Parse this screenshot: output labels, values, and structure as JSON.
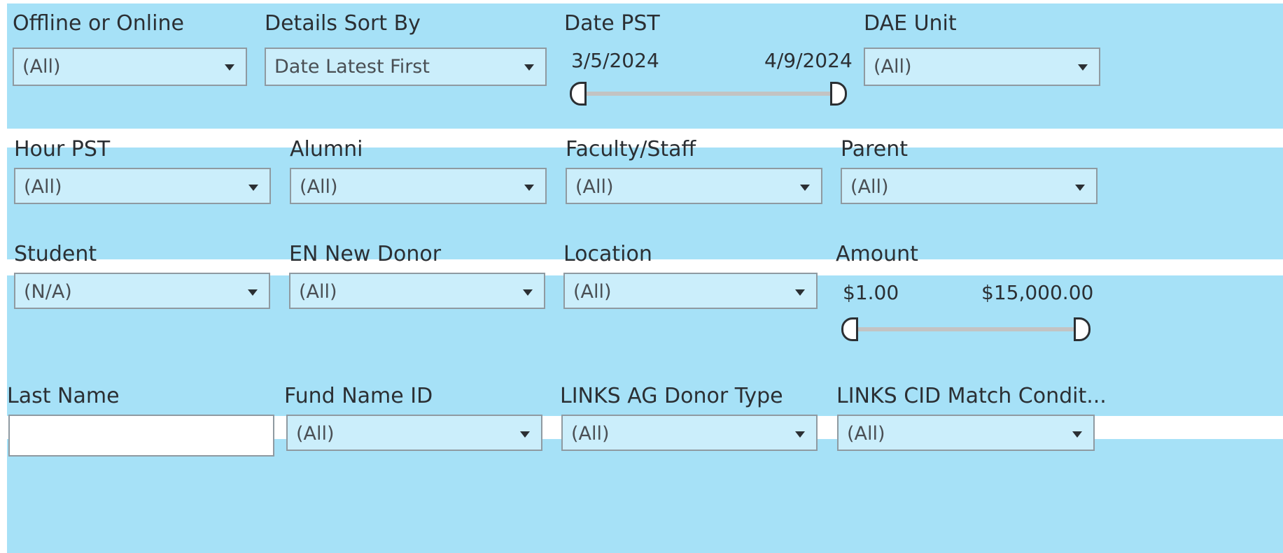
{
  "filters": {
    "offline_online": {
      "label": "Offline or Online",
      "value": "(All)"
    },
    "details_sort": {
      "label": "Details Sort By",
      "value": "Date Latest First"
    },
    "date_pst": {
      "label": "Date PST",
      "min": "3/5/2024",
      "max": "4/9/2024"
    },
    "dae_unit": {
      "label": "DAE Unit",
      "value": "(All)"
    },
    "hour_pst": {
      "label": "Hour PST",
      "value": "(All)"
    },
    "alumni": {
      "label": "Alumni",
      "value": "(All)"
    },
    "faculty_staff": {
      "label": "Faculty/Staff",
      "value": "(All)"
    },
    "parent": {
      "label": "Parent",
      "value": "(All)"
    },
    "student": {
      "label": "Student",
      "value": "(N/A)"
    },
    "en_new_donor": {
      "label": "EN New Donor",
      "value": "(All)"
    },
    "location": {
      "label": "Location",
      "value": "(All)"
    },
    "amount": {
      "label": "Amount",
      "min": "$1.00",
      "max": "$15,000.00"
    },
    "last_name": {
      "label": "Last Name",
      "value": ""
    },
    "fund_name_id": {
      "label": "Fund Name ID",
      "value": "(All)"
    },
    "links_ag_donor_type": {
      "label": "LINKS AG Donor Type",
      "value": "(All)"
    },
    "links_cid_match": {
      "label": "LINKS CID Match Condit...",
      "value": "(All)"
    }
  },
  "colors": {
    "panel_background": "#a6e1f7",
    "dropdown_background": "#cbeefb",
    "border": "#8f9aa1",
    "slider_track": "#c3c3c3"
  },
  "icons": {
    "dropdown": "chevron-down-icon",
    "slider_handle": "slider-handle"
  }
}
